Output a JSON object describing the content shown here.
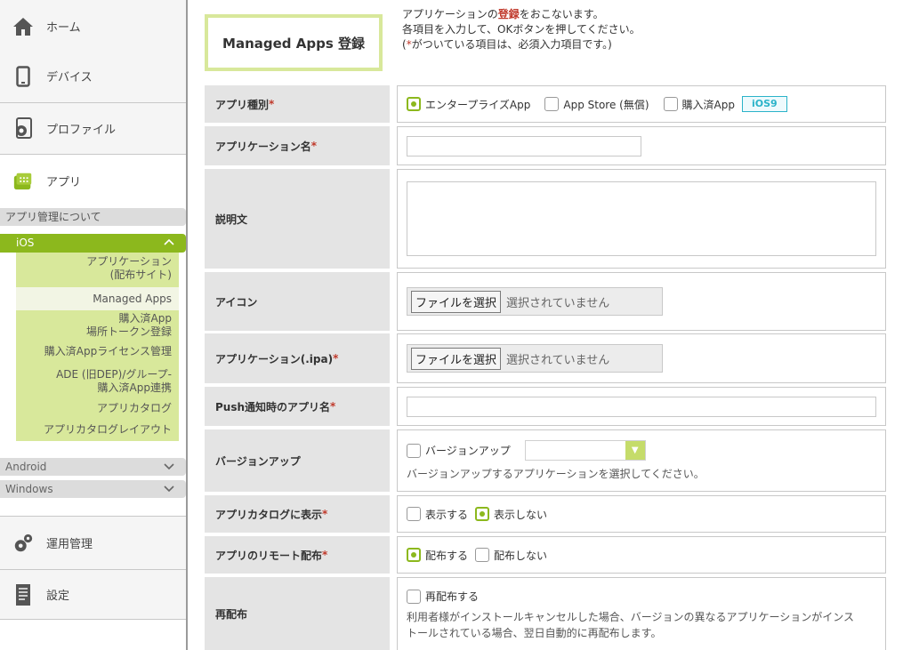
{
  "sidebar": {
    "home": "ホーム",
    "devices": "デバイス",
    "profiles": "プロファイル",
    "apps": "アプリ",
    "about": "アプリ管理について",
    "ios": "iOS",
    "ios_items": [
      "アプリケーション",
      "(配布サイト)",
      "Managed Apps",
      "購入済App",
      "場所トークン登録",
      "購入済Appライセンス管理",
      "ADE (旧DEP)/グループ-",
      "購入済App連携",
      "アプリカタログ",
      "アプリカタログレイアウト"
    ],
    "android": "Android",
    "windows": "Windows",
    "operations": "運用管理",
    "settings": "設定"
  },
  "page": {
    "title": "Managed Apps 登録",
    "intro1_pre": "アプリケーションの",
    "intro1_red": "登録",
    "intro1_post": "をおこないます。",
    "intro2": "各項目を入力して、OKボタンを押してください。",
    "intro3_pre": "(",
    "intro3_star": "*",
    "intro3_post": "がついている項目は、必須入力項目です。)"
  },
  "form": {
    "req": "*",
    "type_label": "アプリ種別",
    "type_opts": [
      "エンタープライズApp",
      "App Store (無償)",
      "購入済App"
    ],
    "ios9": "iOS9",
    "name_label": "アプリケーション名",
    "desc_label": "説明文",
    "icon_label": "アイコン",
    "file_button": "ファイルを選択",
    "file_none": "選択されていません",
    "ipa_label": "アプリケーション(.ipa)",
    "push_label": "Push通知時のアプリ名",
    "version_label": "バージョンアップ",
    "version_check": "バージョンアップ",
    "version_hint": "バージョンアップするアプリケーションを選択してください。",
    "catalog_label": "アプリカタログに表示",
    "catalog_opts": [
      "表示する",
      "表示しない"
    ],
    "remote_label": "アプリのリモート配布",
    "remote_opts": [
      "配布する",
      "配布しない"
    ],
    "redeploy_label": "再配布",
    "redeploy_check": "再配布する",
    "redeploy_note1": "利用者様がインストールキャンセルした場合、バージョンの異なるアプリケーションがインス",
    "redeploy_note2": "トールされている場合、翌日自動的に再配布します。"
  }
}
